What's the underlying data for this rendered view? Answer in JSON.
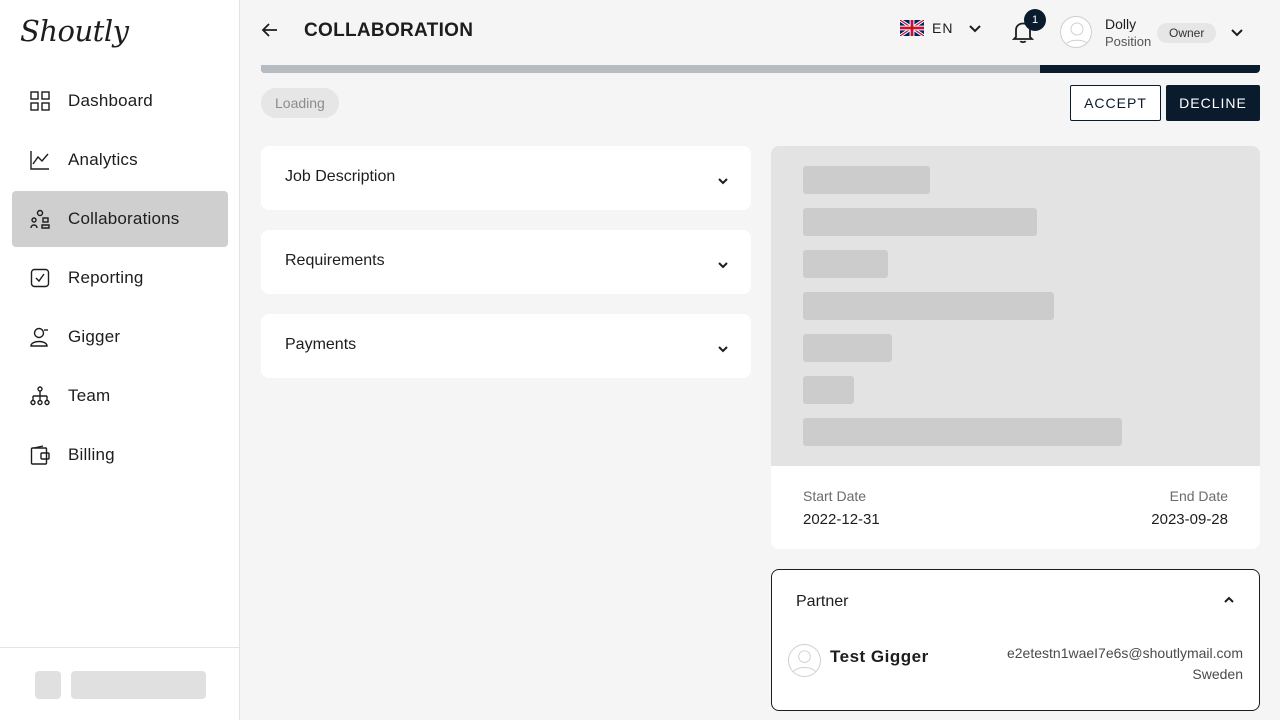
{
  "app": {
    "logo": "Shoutly"
  },
  "sidebar": {
    "items": [
      {
        "label": "Dashboard",
        "icon": "dashboard-icon"
      },
      {
        "label": "Analytics",
        "icon": "analytics-icon"
      },
      {
        "label": "Collaborations",
        "icon": "collaborations-icon",
        "active": true
      },
      {
        "label": "Reporting",
        "icon": "reporting-icon"
      },
      {
        "label": "Gigger",
        "icon": "gigger-icon"
      },
      {
        "label": "Team",
        "icon": "team-icon"
      },
      {
        "label": "Billing",
        "icon": "billing-icon"
      }
    ]
  },
  "header": {
    "title": "COLLABORATION",
    "language": {
      "code": "EN",
      "flag": "uk-flag-icon"
    },
    "notifications": {
      "count": "1"
    },
    "user": {
      "name": "Dolly",
      "position": "Position",
      "role": "Owner"
    }
  },
  "progress": {
    "fraction": 0.78
  },
  "status": {
    "label": "Loading"
  },
  "actions": {
    "accept": "ACCEPT",
    "decline": "DECLINE"
  },
  "sections": [
    {
      "title": "Job Description"
    },
    {
      "title": "Requirements"
    },
    {
      "title": "Payments"
    }
  ],
  "details": {
    "start_label": "Start Date",
    "start_value": "2022-12-31",
    "end_label": "End Date",
    "end_value": "2023-09-28"
  },
  "partner": {
    "title": "Partner",
    "name": "Test Gigger",
    "email": "e2etestn1waeI7e6s@shoutlymail.com",
    "country": "Sweden"
  },
  "colors": {
    "primary": "#0b1b2e",
    "active_nav": "#cfcfcf",
    "background": "#f5f5f5",
    "skeleton": "#cccccc"
  }
}
